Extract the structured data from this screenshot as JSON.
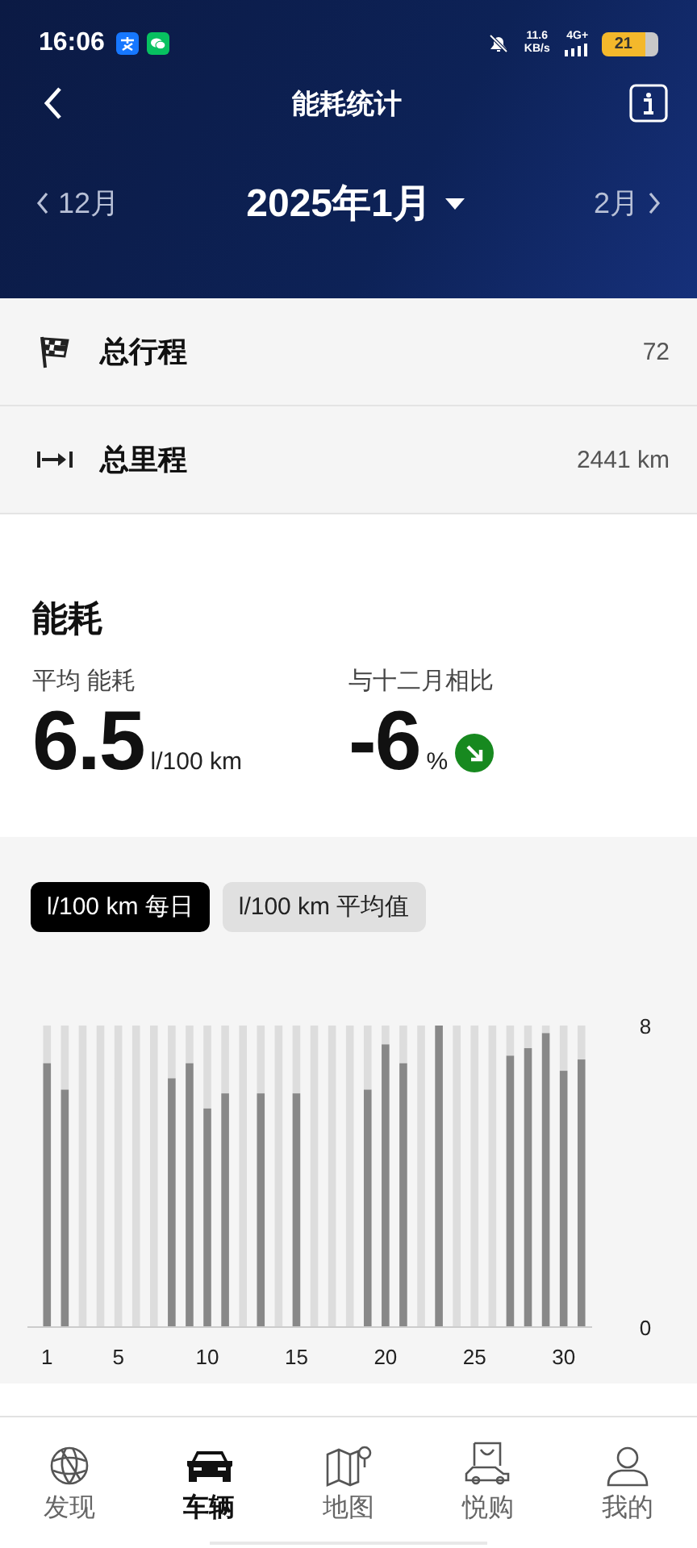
{
  "status_bar": {
    "time": "16:06",
    "net_speed": "11.6",
    "net_unit": "KB/s",
    "network": "4G+",
    "battery": "21"
  },
  "header": {
    "title": "能耗统计",
    "prev_month": "12月",
    "month": "2025年1月",
    "next_month": "2月"
  },
  "summary": [
    {
      "kind": "trips",
      "label": "总行程",
      "value": "72"
    },
    {
      "kind": "distance",
      "label": "总里程",
      "value": "2441 km"
    }
  ],
  "energy": {
    "title": "能耗",
    "average_label": "平均 能耗",
    "average": "6.5",
    "average_unit": "l/100 km",
    "compare_label": "与十二月相比",
    "compare": "-6",
    "compare_unit": "%"
  },
  "chart_tabs": [
    {
      "label": "l/100 km 每日",
      "selected": true
    },
    {
      "label": "l/100 km 平均值",
      "selected": false
    }
  ],
  "chart_data": {
    "type": "bar",
    "x": [
      1,
      2,
      3,
      4,
      5,
      6,
      7,
      8,
      9,
      10,
      11,
      12,
      13,
      14,
      15,
      16,
      17,
      18,
      19,
      20,
      21,
      22,
      23,
      24,
      25,
      26,
      27,
      28,
      29,
      30,
      31
    ],
    "values": [
      7.0,
      6.3,
      null,
      null,
      null,
      null,
      null,
      6.6,
      7.0,
      5.8,
      6.2,
      null,
      6.2,
      null,
      6.2,
      null,
      null,
      null,
      6.3,
      7.5,
      7.0,
      null,
      8.0,
      null,
      null,
      null,
      7.2,
      7.4,
      7.8,
      6.8,
      7.1
    ],
    "xlim": [
      -0.1,
      31.6
    ],
    "ylim": [
      0,
      8
    ],
    "yticks": [
      0,
      8
    ],
    "xticks": [
      1,
      5,
      10,
      15,
      20,
      25,
      30
    ]
  },
  "nav": [
    {
      "kind": "discover",
      "label": "发现",
      "selected": false
    },
    {
      "kind": "vehicle",
      "label": "车辆",
      "selected": true
    },
    {
      "kind": "map",
      "label": "地图",
      "selected": false
    },
    {
      "kind": "shop",
      "label": "悦购",
      "selected": false
    },
    {
      "kind": "me",
      "label": "我的",
      "selected": false
    }
  ]
}
